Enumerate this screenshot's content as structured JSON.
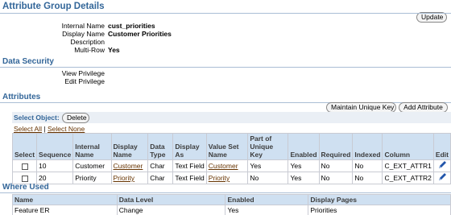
{
  "page": {
    "title": "Attribute Group Details",
    "update_label": "Update"
  },
  "details": {
    "fields": [
      {
        "label": "Internal Name",
        "value": "cust_priorities"
      },
      {
        "label": "Display Name",
        "value": "Customer Priorities"
      },
      {
        "label": "Description",
        "value": ""
      },
      {
        "label": "Multi-Row",
        "value": "Yes"
      }
    ]
  },
  "data_security": {
    "title": "Data Security",
    "fields": [
      {
        "label": "View Privilege",
        "value": ""
      },
      {
        "label": "Edit Privilege",
        "value": ""
      }
    ]
  },
  "attributes": {
    "title": "Attributes",
    "maintain_key_label": "Maintain Unique Key",
    "add_attribute_label": "Add Attribute",
    "select_object_label": "Select Object:",
    "delete_label": "Delete",
    "select_all_label": "Select All",
    "select_none_label": "Select None",
    "columns": [
      "Select",
      "Sequence",
      "Internal Name",
      "Display Name",
      "Data Type",
      "Display As",
      "Value Set Name",
      "Part of Unique Key",
      "Enabled",
      "Required",
      "Indexed",
      "Column",
      "Edit"
    ],
    "rows": [
      {
        "sequence": "10",
        "internal_name": "Customer",
        "display_name": "Customer",
        "data_type": "Char",
        "display_as": "Text Field",
        "value_set": "Customer",
        "unique_key": "Yes",
        "enabled": "Yes",
        "required": "No",
        "indexed": "No",
        "column": "C_EXT_ATTR1"
      },
      {
        "sequence": "20",
        "internal_name": "Priority",
        "display_name": "Priority",
        "data_type": "Char",
        "display_as": "Text Field",
        "value_set": "Priority",
        "unique_key": "No",
        "enabled": "Yes",
        "required": "No",
        "indexed": "No",
        "column": "C_EXT_ATTR2"
      }
    ]
  },
  "where_used": {
    "title": "Where Used",
    "columns": [
      "Name",
      "Data Level",
      "Enabled",
      "Display Pages"
    ],
    "rows": [
      {
        "name": "Feature ER",
        "data_level": "Change",
        "enabled": "Yes",
        "display_pages": "Priorities"
      }
    ]
  },
  "colors": {
    "heading": "#336699",
    "table_header": "#cfe0f1",
    "link": "#663300",
    "pencil": "#2255aa"
  }
}
